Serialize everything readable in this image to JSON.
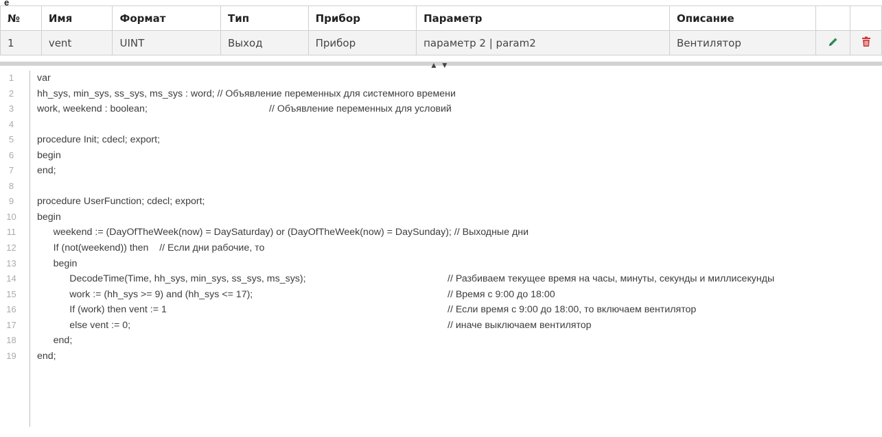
{
  "header_fragment": "е",
  "table": {
    "headers": [
      "№",
      "Имя",
      "Формат",
      "Тип",
      "Прибор",
      "Параметр",
      "Описание"
    ],
    "row": [
      "1",
      "vent",
      "UINT",
      "Выход",
      "Прибор",
      "параметр 2 | param2",
      "Вентилятор"
    ],
    "edit_icon_color": "#2e8b57",
    "delete_icon_color": "#cc3333"
  },
  "editor": {
    "line_numbers": [
      "1",
      "2",
      "3",
      "4",
      "5",
      "6",
      "7",
      "8",
      "9",
      "10",
      "11",
      "12",
      "13",
      "14",
      "15",
      "16",
      "17",
      "18",
      "19"
    ],
    "lines": [
      {
        "code": "var",
        "comment": ""
      },
      {
        "code": "hh_sys, min_sys, ss_sys, ms_sys : word; // Объявление переменных для системного времени",
        "comment": ""
      },
      {
        "code": "work, weekend : boolean;",
        "comment": "// Объявление переменных для условий"
      },
      {
        "code": "",
        "comment": ""
      },
      {
        "code": "procedure Init; cdecl; export;",
        "comment": ""
      },
      {
        "code": "begin",
        "comment": ""
      },
      {
        "code": "end;",
        "comment": ""
      },
      {
        "code": "",
        "comment": ""
      },
      {
        "code": "procedure UserFunction; cdecl; export;",
        "comment": ""
      },
      {
        "code": "begin",
        "comment": ""
      },
      {
        "code": "      weekend := (DayOfTheWeek(now) = DaySaturday) or (DayOfTheWeek(now) = DaySunday); // Выходные дни",
        "comment": ""
      },
      {
        "code": "      If (not(weekend)) then    // Если дни рабочие, то",
        "comment": ""
      },
      {
        "code": "      begin",
        "comment": ""
      },
      {
        "code": "            DecodeTime(Time, hh_sys, min_sys, ss_sys, ms_sys);",
        "comment": "// Разбиваем текущее время на часы, минуты, секунды и миллисекунды"
      },
      {
        "code": "            work := (hh_sys >= 9) and (hh_sys <= 17);",
        "comment": "// Время с 9:00 до 18:00"
      },
      {
        "code": "            If (work) then vent := 1",
        "comment": "// Если время с 9:00 до 18:00, то включаем вентилятор"
      },
      {
        "code": "            else vent := 0;",
        "comment": "// иначе выключаем вентилятор"
      },
      {
        "code": "      end;",
        "comment": ""
      },
      {
        "code": "end;",
        "comment": ""
      }
    ]
  }
}
